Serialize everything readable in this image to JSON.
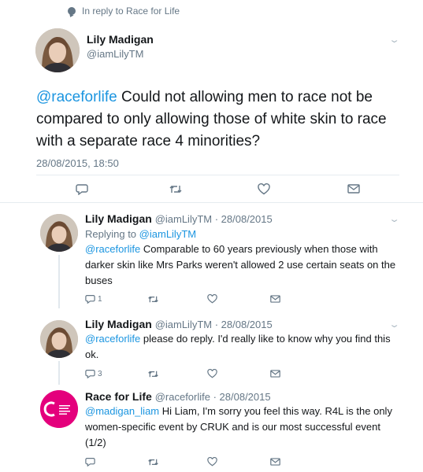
{
  "reply_context": {
    "prefix": "In reply to",
    "target": "Race for Life"
  },
  "main_tweet": {
    "name": "Lily Madigan",
    "handle": "@iamLilyTM",
    "mention": "@raceforlife",
    "text": " Could not allowing men to race not be compared to only allowing those of white skin to race with a separate race 4 minorities?",
    "date": "28/08/2015, 18:50"
  },
  "replies": [
    {
      "name": "Lily Madigan",
      "meta": "@iamLilyTM · 28/08/2015",
      "replying_prefix": "Replying to",
      "replying_handle": "@iamLilyTM",
      "mention": "@raceforlife",
      "text": " Comparable to 60 years previously when those with darker skin like Mrs Parks weren't allowed 2 use certain seats on the buses",
      "reply_count": "1"
    },
    {
      "name": "Lily Madigan",
      "meta": "@iamLilyTM · 28/08/2015",
      "mention": "@raceforlife",
      "text": " please do reply. I'd really like to know why you find this ok.",
      "reply_count": "3"
    },
    {
      "name": "Race for Life",
      "meta": "@raceforlife · 28/08/2015",
      "mention": "@madigan_liam",
      "text": " Hi Liam, I'm sorry you feel this way. R4L is the only women-specific event by CRUK and is our most successful event (1/2)",
      "reply_count": "",
      "logo_text": "CANCER RESEARCH UK RACE FOR LIFE"
    }
  ],
  "icons": {
    "reply": "reply-icon",
    "retweet": "retweet-icon",
    "like": "heart-icon",
    "dm": "envelope-icon",
    "caret": "chevron-down-icon"
  },
  "colors": {
    "link": "#1b95e0",
    "muted": "#657786",
    "cruk_pink": "#e4007c"
  }
}
